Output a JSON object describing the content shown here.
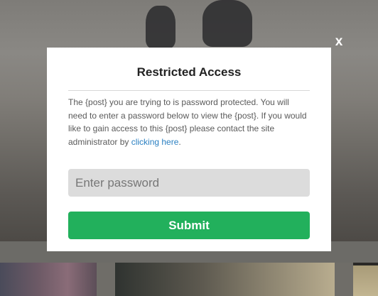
{
  "modal": {
    "close_label": "x",
    "title": "Restricted Access",
    "message_before_link": "The {post} you are trying to is password protected. You will need to enter a password below to view the {post}. If you would like to gain access to this {post} please contact the site administrator by ",
    "link_text": "clicking here",
    "message_after_link": ".",
    "password_placeholder": "Enter password",
    "submit_label": "Submit"
  },
  "colors": {
    "submit_button": "#22b05c",
    "link": "#2b80c2",
    "input_background": "#dcdcdc"
  }
}
